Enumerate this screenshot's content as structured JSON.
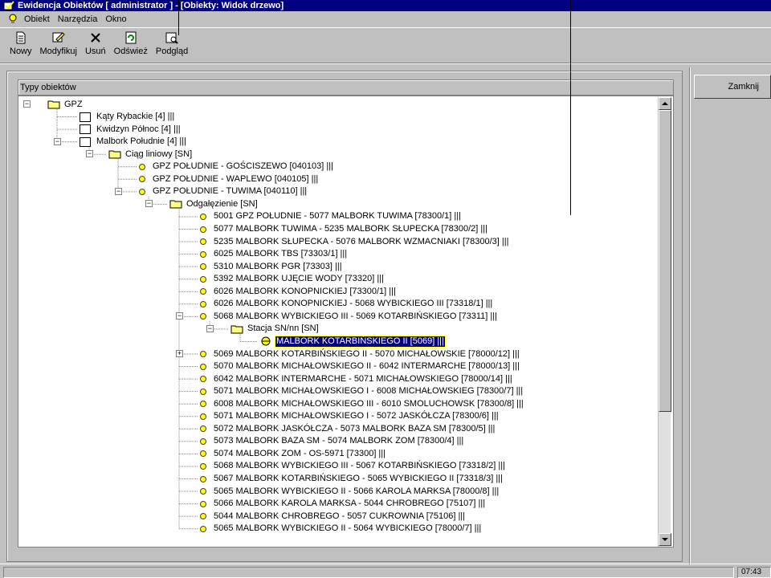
{
  "window": {
    "title": "Ewidencja Obiektów [ administrator ] - [Obiekty: Widok drzewo]"
  },
  "menu": [
    "Obiekt",
    "Narzędzia",
    "Okno"
  ],
  "toolbar": {
    "buttons": [
      {
        "label": "Nowy",
        "icon": "new-document-icon"
      },
      {
        "label": "Modyfikuj",
        "icon": "edit-icon"
      },
      {
        "label": "Usuń",
        "icon": "delete-x-icon"
      },
      {
        "label": "Odśwież",
        "icon": "refresh-icon"
      },
      {
        "label": "Podgląd",
        "icon": "preview-icon"
      }
    ]
  },
  "panel": {
    "header": "Typy obiektów",
    "close_label": "Zamknij"
  },
  "tree": [
    {
      "level": 0,
      "icon": "folder",
      "label": "GPZ",
      "expander": "minus"
    },
    {
      "level": 1,
      "icon": "box",
      "label": "Kąty Rybackie [4] |||"
    },
    {
      "level": 1,
      "icon": "box",
      "label": "Kwidzyn Północ [4] |||"
    },
    {
      "level": 1,
      "icon": "box",
      "label": "Malbork Południe [4] |||",
      "expander": "minus"
    },
    {
      "level": 2,
      "icon": "folder",
      "label": "Ciąg liniowy [SN]",
      "expander": "minus"
    },
    {
      "level": 3,
      "icon": "dot",
      "label": "GPZ POŁUDNIE - GOŚCISZEWO [040103] |||"
    },
    {
      "level": 3,
      "icon": "dot",
      "label": "GPZ POŁUDNIE - WAPLEWO [040105] |||"
    },
    {
      "level": 3,
      "icon": "dot",
      "label": "GPZ POŁUDNIE - TUWIMA [040110] |||",
      "expander": "minus"
    },
    {
      "level": 4,
      "icon": "folder",
      "label": "Odgałęzienie [SN]",
      "expander": "minus"
    },
    {
      "level": 5,
      "icon": "dot",
      "label": "5001 GPZ POŁUDNIE - 5077 MALBORK TUWIMA [78300/1] |||"
    },
    {
      "level": 5,
      "icon": "dot",
      "label": "5077 MALBORK TUWIMA - 5235 MALBORK SŁUPECKA [78300/2] |||"
    },
    {
      "level": 5,
      "icon": "dot",
      "label": "5235 MALBORK SŁUPECKA - 5076 MALBORK WZMACNIAKI [78300/3] |||"
    },
    {
      "level": 5,
      "icon": "dot",
      "label": "6025 MALBORK TBS [73303/1] |||"
    },
    {
      "level": 5,
      "icon": "dot",
      "label": "5310 MALBORK PGR [73303] |||"
    },
    {
      "level": 5,
      "icon": "dot",
      "label": "5392 MALBORK UJĘCIE WODY [73320] |||"
    },
    {
      "level": 5,
      "icon": "dot",
      "label": "6026 MALBORK KONOPNICKIEJ [73300/1] |||"
    },
    {
      "level": 5,
      "icon": "dot",
      "label": "6026 MALBORK KONOPNICKIEJ - 5068 WYBICKIEGO III [73318/1] |||"
    },
    {
      "level": 5,
      "icon": "dot",
      "label": "5068 MALBORK WYBICKIEGO III - 5069 KOTARBIŃSKIEGO [73311] |||",
      "expander": "minus"
    },
    {
      "level": 6,
      "icon": "folder",
      "label": "Stacja SN/nn [SN]",
      "expander": "minus"
    },
    {
      "level": 7,
      "icon": "station",
      "label": "MALBORK KOTARBIŃSKIEGO II [5069] |||",
      "selected": true
    },
    {
      "level": 5,
      "icon": "dot",
      "label": "5069 MALBORK KOTARBIŃSKIEGO II - 5070 MICHAŁOWSKIE [78000/12] |||",
      "expander": "plus"
    },
    {
      "level": 5,
      "icon": "dot",
      "label": "5070 MALBORK MICHAŁOWSKIEGO II - 6042 INTERMARCHE [78000/13] |||"
    },
    {
      "level": 5,
      "icon": "dot",
      "label": "6042 MALBORK INTERMARCHE - 5071 MICHAŁOWSKIEGO [78000/14] |||"
    },
    {
      "level": 5,
      "icon": "dot",
      "label": "5071 MALBORK MICHAŁOWSKIEGO I - 6008 MICHAŁOWSKIEG [78300/7] |||"
    },
    {
      "level": 5,
      "icon": "dot",
      "label": "6008 MALBORK MICHAŁOWSKIEGO III - 6010 SMOLUCHOWSK [78300/8] |||"
    },
    {
      "level": 5,
      "icon": "dot",
      "label": "5071 MALBORK MICHAŁOWSKIEGO I - 5072 JASKÓŁCZA [78300/6] |||"
    },
    {
      "level": 5,
      "icon": "dot",
      "label": "5072 MALBORK JASKÓŁCZA - 5073 MALBORK BAZA SM [78300/5] |||"
    },
    {
      "level": 5,
      "icon": "dot",
      "label": "5073 MALBORK BAZA SM - 5074 MALBORK ZOM [78300/4] |||"
    },
    {
      "level": 5,
      "icon": "dot",
      "label": "5074 MALBORK ZOM - OS-5971 [73300] |||"
    },
    {
      "level": 5,
      "icon": "dot",
      "label": "5068 MALBORK WYBICKIEGO III - 5067 KOTARBIŃSKIEGO [73318/2] |||"
    },
    {
      "level": 5,
      "icon": "dot",
      "label": "5067 MALBORK KOTARBIŃSKIEGO - 5065 WYBICKIEGO II [73318/3] |||"
    },
    {
      "level": 5,
      "icon": "dot",
      "label": "5065 MALBORK WYBICKIEGO II - 5066 KAROLA MARKSA [78000/8] |||"
    },
    {
      "level": 5,
      "icon": "dot",
      "label": "5066 MALBORK KAROLA MARKSA - 5044 CHROBREGO [75107] |||"
    },
    {
      "level": 5,
      "icon": "dot",
      "label": "5044 MALBORK CHROBREGO - 5057 CUKROWNIA [75106] |||"
    },
    {
      "level": 5,
      "icon": "dot",
      "label": "5065 MALBORK WYBICKIEGO II - 5064 WYBICKIEGO [78000/7] |||"
    }
  ],
  "status": {
    "time": "07:43"
  }
}
